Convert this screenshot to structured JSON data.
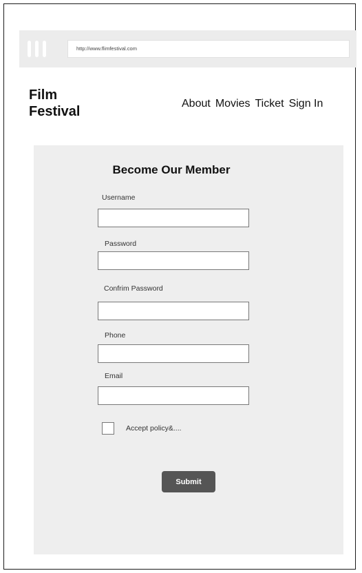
{
  "browser": {
    "url": "http://www.flimfestival.com"
  },
  "site": {
    "title": "Film Festival"
  },
  "nav": {
    "items": [
      "About",
      "Movies",
      "Ticket",
      "Sign In"
    ]
  },
  "form": {
    "title": "Become Our Member",
    "fields": [
      {
        "label": "Username",
        "value": ""
      },
      {
        "label": "Password",
        "value": ""
      },
      {
        "label": "Confrim Password",
        "value": ""
      },
      {
        "label": "Phone",
        "value": ""
      },
      {
        "label": "Email",
        "value": ""
      }
    ],
    "checkbox_label": "Accept policy&....",
    "checkbox_checked": false,
    "submit_label": "Submit"
  },
  "colors": {
    "panel_background": "#eeeeee",
    "browser_bar": "#ececec",
    "submit_button": "#555555"
  }
}
